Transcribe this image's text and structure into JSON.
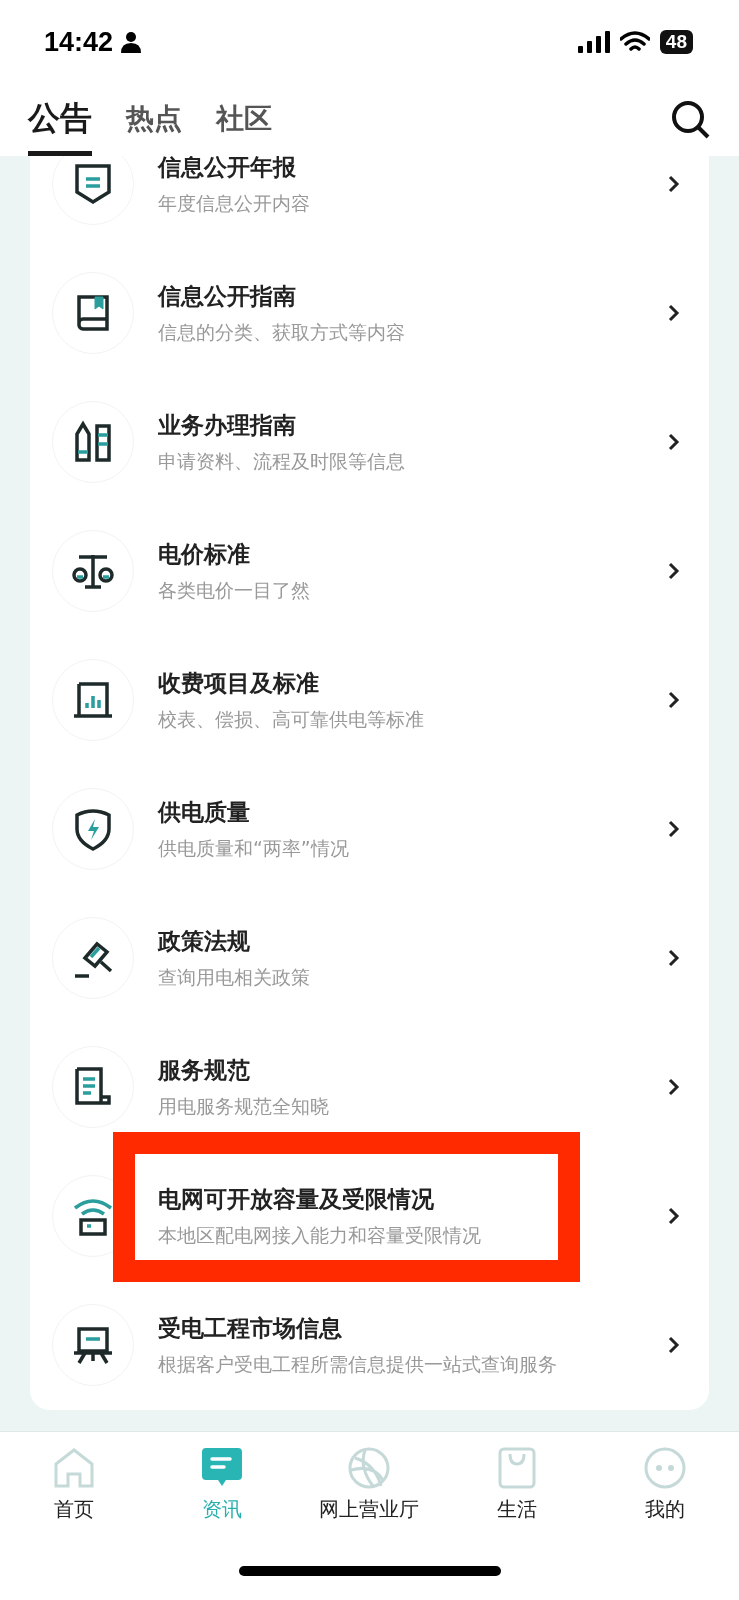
{
  "status_bar": {
    "time": "14:42",
    "battery": "48"
  },
  "tabs": [
    {
      "label": "公告",
      "selected": true
    },
    {
      "label": "热点",
      "selected": false
    },
    {
      "label": "社区",
      "selected": false
    }
  ],
  "items": [
    {
      "kind": "shield-doc",
      "title": "信息公开年报",
      "subtitle": "年度信息公开内容",
      "highlighted": false
    },
    {
      "kind": "book",
      "title": "信息公开指南",
      "subtitle": "信息的分类、获取方式等内容",
      "highlighted": false
    },
    {
      "kind": "pencils",
      "title": "业务办理指南",
      "subtitle": "申请资料、流程及时限等信息",
      "highlighted": false
    },
    {
      "kind": "scale",
      "title": "电价标准",
      "subtitle": "各类电价一目了然",
      "highlighted": false
    },
    {
      "kind": "chart",
      "title": "收费项目及标准",
      "subtitle": "校表、偿损、高可靠供电等标准",
      "highlighted": false
    },
    {
      "kind": "bolt",
      "title": "供电质量",
      "subtitle": "供电质量和“两率”情况",
      "highlighted": false
    },
    {
      "kind": "gavel",
      "title": "政策法规",
      "subtitle": "查询用电相关政策",
      "highlighted": false
    },
    {
      "kind": "scroll",
      "title": "服务规范",
      "subtitle": "用电服务规范全知晓",
      "highlighted": false
    },
    {
      "kind": "signal",
      "title": "电网可开放容量及受限情况",
      "subtitle": "本地区配电网接入能力和容量受限情况",
      "highlighted": true
    },
    {
      "kind": "board",
      "title": "受电工程市场信息",
      "subtitle": "根据客户受电工程所需信息提供一站式查询服务",
      "highlighted": false
    }
  ],
  "nav": [
    {
      "kind": "home",
      "label": "首页",
      "selected": false
    },
    {
      "kind": "news",
      "label": "资讯",
      "selected": true
    },
    {
      "kind": "globe",
      "label": "网上营业厅",
      "selected": false
    },
    {
      "kind": "bag",
      "label": "生活",
      "selected": false
    },
    {
      "kind": "face",
      "label": "我的",
      "selected": false
    }
  ]
}
